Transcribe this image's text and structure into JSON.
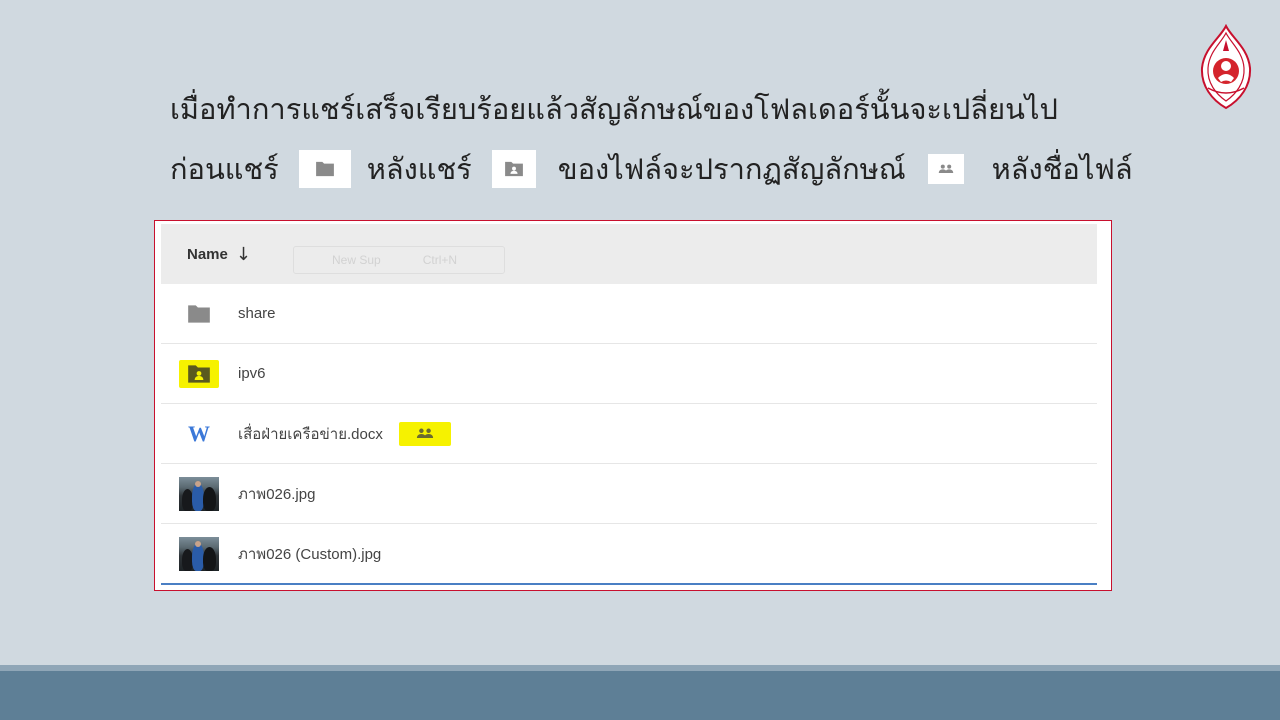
{
  "slide": {
    "line1": "เมื่อทำการแชร์เสร็จเรียบร้อยแล้วสัญลักษณ์ของโฟลเดอร์นั้นจะเปลี่ยนไป",
    "line2_before": "ก่อนแชร์",
    "line2_after": "หลังแชร์",
    "line2_file": "ของไฟล์จะปรากฏสัญลักษณ์",
    "line2_end": "หลังชื่อไฟล์"
  },
  "drive": {
    "header": {
      "name_label": "Name",
      "sort_arrow": "↓"
    },
    "ghost_menu": {
      "item": "New Sup",
      "shortcut": "Ctrl+N"
    },
    "files": [
      {
        "name": "share",
        "icon": "folder-icon"
      },
      {
        "name": "ipv6",
        "icon": "shared-folder-icon",
        "highlight": true
      },
      {
        "name": "เสื่อฝ่ายเครือข่าย.docx",
        "icon": "word-doc-icon",
        "shared": true
      },
      {
        "name": "ภาพ026.jpg",
        "icon": "photo-thumbnail"
      },
      {
        "name": "ภาพ026 (Custom).jpg",
        "icon": "photo-thumbnail"
      }
    ],
    "word_glyph": "W"
  },
  "colors": {
    "background": "#d0d9e0",
    "footer": "#5e7f96",
    "panel_border": "#c8102e",
    "highlight": "#f6f200",
    "icon_gray": "#8a8a8a",
    "word_blue": "#3b78d8",
    "selection_line": "#4a7fc4"
  }
}
